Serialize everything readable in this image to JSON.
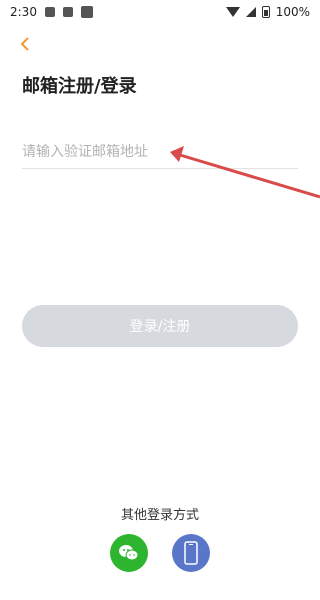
{
  "status_bar": {
    "time": "2:30",
    "battery": "100%"
  },
  "header": {
    "title": "邮箱注册/登录"
  },
  "email_field": {
    "placeholder": "请输入验证邮箱地址",
    "value": ""
  },
  "actions": {
    "login_label": "登录/注册"
  },
  "other_login": {
    "title": "其他登录方式",
    "options": [
      "wechat-icon",
      "phone-icon"
    ]
  },
  "colors": {
    "accent": "#f39a30",
    "button_disabled": "#d6d9dd",
    "wechat": "#2db52f",
    "phone": "#5a76c8",
    "arrow": "#d94a4a"
  }
}
